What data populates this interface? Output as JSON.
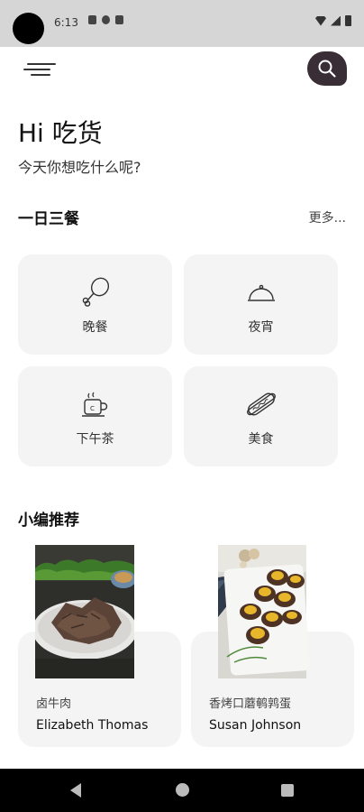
{
  "status_bar": {
    "time": "6:13"
  },
  "header": {
    "menu_icon": "hamburger-menu-icon",
    "search_icon": "search-icon"
  },
  "greeting": {
    "title": "Hi 吃货",
    "subtitle": "今天你想吃什么呢?"
  },
  "meals": {
    "title": "一日三餐",
    "more": "更多...",
    "items": [
      {
        "label": "晚餐",
        "icon": "drumstick-icon"
      },
      {
        "label": "夜宵",
        "icon": "cloche-icon"
      },
      {
        "label": "下午茶",
        "icon": "tea-cup-icon"
      },
      {
        "label": "美食",
        "icon": "hotdog-icon"
      }
    ]
  },
  "recommend": {
    "title": "小编推荐",
    "items": [
      {
        "name": "卤牛肉",
        "author": "Elizabeth Thomas"
      },
      {
        "name": "香烤口蘑鹌鹑蛋",
        "author": "Susan Johnson"
      }
    ]
  },
  "colors": {
    "search_button": "#3a2e36",
    "card_bg": "#f4f4f4"
  }
}
